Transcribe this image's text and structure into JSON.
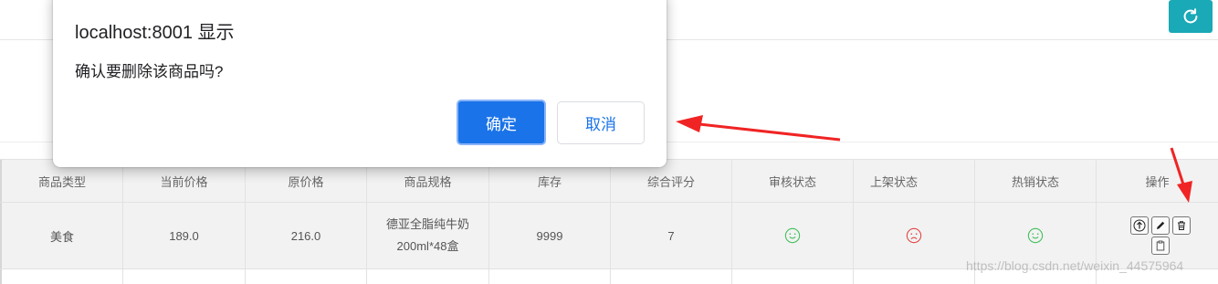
{
  "dialog": {
    "title": "localhost:8001 显示",
    "message": "确认要删除该商品吗?",
    "ok_label": "确定",
    "cancel_label": "取消"
  },
  "toolbar": {
    "refresh_icon": "refresh-icon",
    "accent_color": "#1aa9b6"
  },
  "table": {
    "headers": [
      "商品类型",
      "当前价格",
      "原价格",
      "商品规格",
      "库存",
      "综合评分",
      "审核状态",
      "上架状态",
      "热销状态",
      "操作"
    ],
    "rows": [
      {
        "type": "美食",
        "price": "189.0",
        "original_price": "216.0",
        "spec": "德亚全脂纯牛奶200ml*48盒",
        "stock": "9999",
        "rating": "7",
        "audit_status": "smile-icon",
        "shelf_status": "frown-icon",
        "hot_status": "smile-icon",
        "actions": [
          "up-arrow-icon",
          "edit-icon",
          "trash-icon",
          "clipboard-icon"
        ]
      }
    ]
  },
  "colors": {
    "ok_button": "#1a73e8",
    "status_positive": "#3fbf5a",
    "status_negative": "#e04545",
    "annotation_arrow": "#f02424"
  },
  "watermark": "https://blog.csdn.net/weixin_44575964"
}
